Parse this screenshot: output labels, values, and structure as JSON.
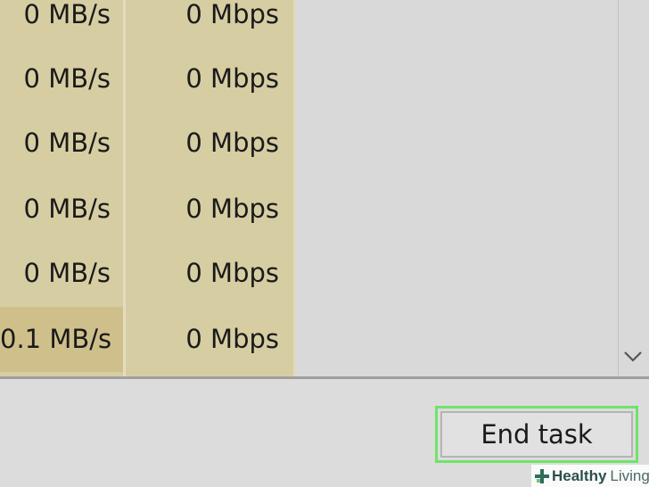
{
  "table": {
    "rows": [
      {
        "disk": "0 MB/s",
        "network": "0 Mbps",
        "highlight": false
      },
      {
        "disk": "0 MB/s",
        "network": "0 Mbps",
        "highlight": false
      },
      {
        "disk": "0 MB/s",
        "network": "0 Mbps",
        "highlight": false
      },
      {
        "disk": "0 MB/s",
        "network": "0 Mbps",
        "highlight": false
      },
      {
        "disk": "0 MB/s",
        "network": "0 Mbps",
        "highlight": false
      },
      {
        "disk": "0.1 MB/s",
        "network": "0 Mbps",
        "highlight": true
      }
    ]
  },
  "footer": {
    "end_task_label": "End task"
  },
  "watermark": {
    "brand_bold": "Healthy",
    "brand_light": "Living"
  },
  "colors": {
    "cell_bg": "#d7cda3",
    "highlight_bg": "#cfc08b",
    "button_highlight": "#6fe36a"
  },
  "icons": {
    "scroll_down": "chevron-down-icon",
    "watermark_logo": "cross-logo-icon"
  }
}
